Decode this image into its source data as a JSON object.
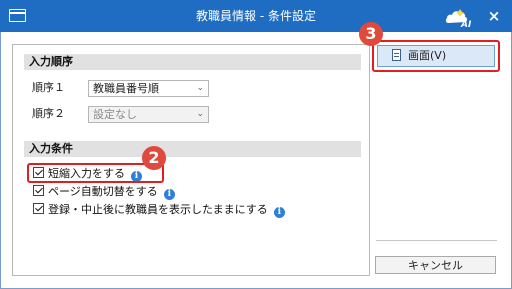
{
  "window": {
    "title": "教職員情報 - 条件設定",
    "icons": [
      "window-icon",
      "ai-assistant-icon",
      "close-icon"
    ]
  },
  "sort_section": {
    "heading": "入力順序",
    "rows": [
      {
        "label": "順序１",
        "value": "教職員番号順",
        "enabled": true
      },
      {
        "label": "順序２",
        "value": "設定なし",
        "enabled": false
      }
    ]
  },
  "input_section": {
    "heading": "入力条件",
    "options": [
      {
        "label": "短縮入力をする",
        "checked": true
      },
      {
        "label": "ページ自動切替をする",
        "checked": true
      },
      {
        "label": "登録・中止後に教職員を表示したままにする",
        "checked": true
      }
    ]
  },
  "side": {
    "screen_button": "画面(V)",
    "cancel_button": "キャンセル"
  },
  "annotations": {
    "badge_2": "2",
    "badge_3": "3",
    "highlight_color": "#e02020"
  },
  "colors": {
    "titlebar": "#1f6dc2",
    "info_icon": "#2f7fd6"
  }
}
